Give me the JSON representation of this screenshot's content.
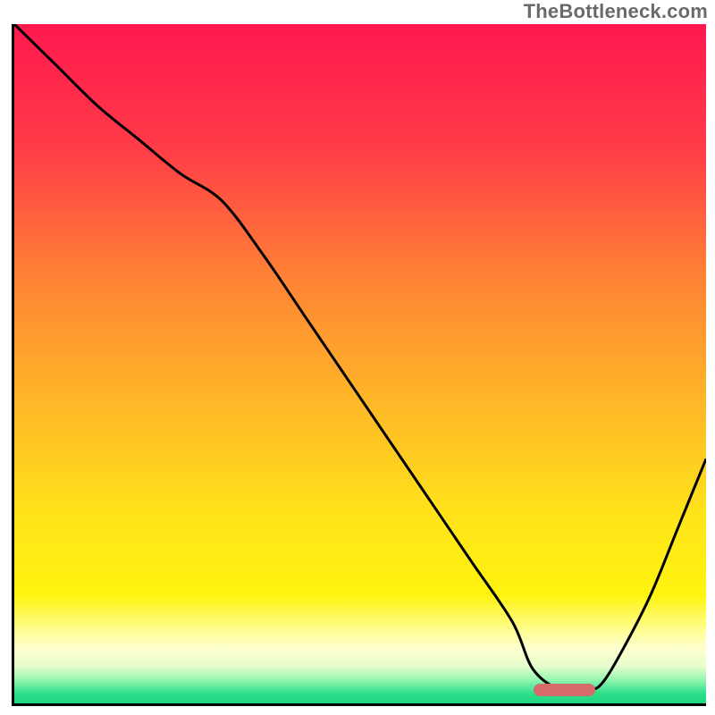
{
  "watermark": "TheBottleneck.com",
  "chart_data": {
    "type": "line",
    "title": "",
    "xlabel": "",
    "ylabel": "",
    "xlim": [
      0,
      100
    ],
    "ylim": [
      0,
      100
    ],
    "grid": false,
    "legend": false,
    "background_gradient": {
      "stops": [
        {
          "offset": 0.0,
          "color": "#ff184e"
        },
        {
          "offset": 0.18,
          "color": "#ff3b48"
        },
        {
          "offset": 0.38,
          "color": "#ff8534"
        },
        {
          "offset": 0.55,
          "color": "#ffb528"
        },
        {
          "offset": 0.72,
          "color": "#ffe31a"
        },
        {
          "offset": 0.84,
          "color": "#fff40f"
        },
        {
          "offset": 0.9,
          "color": "#ffffa4"
        },
        {
          "offset": 0.92,
          "color": "#fdffd1"
        },
        {
          "offset": 0.945,
          "color": "#e7fecb"
        },
        {
          "offset": 0.965,
          "color": "#95f6b0"
        },
        {
          "offset": 0.985,
          "color": "#2fe08b"
        },
        {
          "offset": 1.0,
          "color": "#1fd682"
        }
      ]
    },
    "series": [
      {
        "name": "curve",
        "color": "#000000",
        "x": [
          0,
          6,
          12,
          18,
          24,
          30,
          36,
          42,
          48,
          54,
          60,
          66,
          72,
          75,
          79,
          83,
          85,
          88,
          92,
          96,
          100
        ],
        "y": [
          100,
          94,
          88,
          83,
          78,
          74,
          66,
          57,
          48,
          39,
          30,
          21,
          12,
          5,
          2,
          2,
          3,
          8,
          16,
          26,
          36
        ]
      }
    ],
    "marker_segment": {
      "name": "highlight-bar",
      "color": "#d66b6b",
      "x_start": 75,
      "x_end": 84,
      "y": 2
    }
  }
}
